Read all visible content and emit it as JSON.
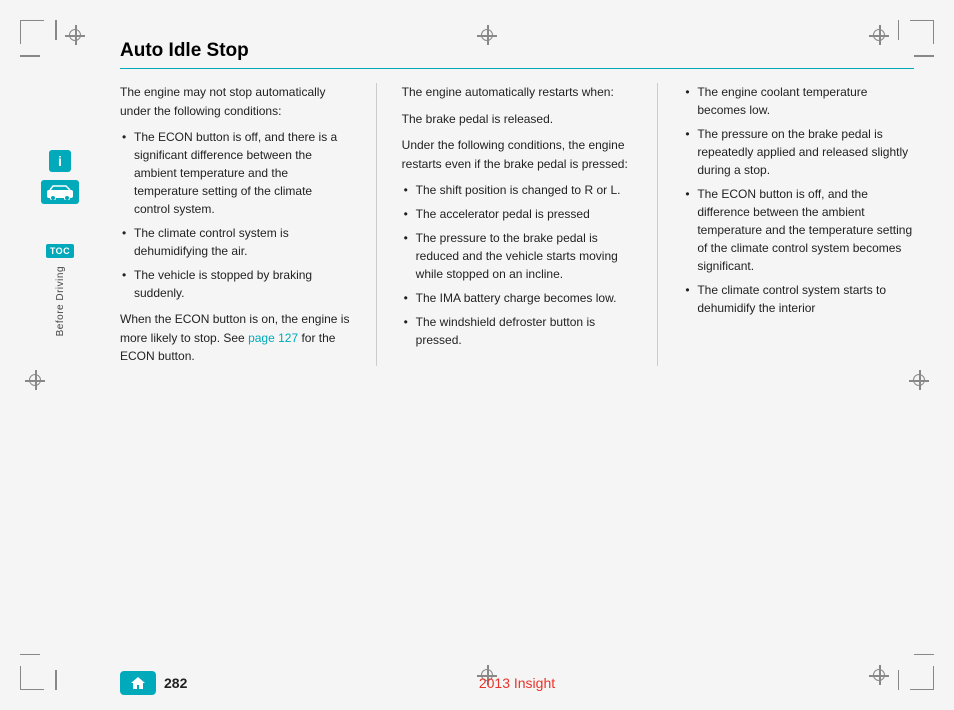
{
  "page": {
    "title": "Auto Idle Stop",
    "number": "282",
    "book_title": "2013 Insight"
  },
  "sidebar": {
    "info_icon": "i",
    "toc_label": "TOC",
    "before_driving_label": "Before Driving"
  },
  "columns": [
    {
      "id": "col1",
      "paragraphs": [
        "The engine may not stop automatically under the following conditions:"
      ],
      "bullets": [
        "The ECON button is off, and there is a significant difference between the ambient temperature and the temperature setting of the climate control system.",
        "The climate control system is dehumidifying the air.",
        "The vehicle is stopped by braking suddenly."
      ],
      "footer_text": "When the ECON button is on, the engine is more likely to stop. See ",
      "footer_link_text": "page 127",
      "footer_link_suffix": " for the ECON button."
    },
    {
      "id": "col2",
      "paragraphs": [
        "The engine automatically restarts when:",
        "The brake pedal is released.",
        "Under the following conditions, the engine restarts even if the brake pedal is pressed:"
      ],
      "bullets": [
        "The shift position is changed to R or L.",
        "The accelerator pedal is pressed",
        "The pressure to the brake pedal is reduced and the vehicle starts moving while stopped on an incline.",
        "The IMA battery charge becomes low.",
        "The windshield defroster button is pressed."
      ]
    },
    {
      "id": "col3",
      "bullets": [
        "The engine coolant temperature becomes low.",
        "The pressure on the brake pedal is repeatedly applied and released slightly during a stop.",
        "The ECON button is off, and the difference between the ambient temperature and the temperature setting of the climate control system becomes significant.",
        "The climate control system starts to dehumidify the interior"
      ]
    }
  ]
}
